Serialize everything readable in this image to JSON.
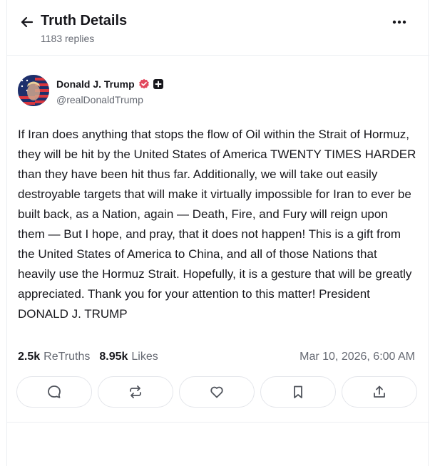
{
  "header": {
    "title": "Truth Details",
    "replies_count": "1183 replies",
    "back_icon": "arrow-left-icon",
    "more_icon": "more-horizontal-icon"
  },
  "author": {
    "display_name": "Donald J. Trump",
    "handle": "@realDonaldTrump",
    "verified_badge_color": "#e2475c"
  },
  "post": {
    "text": "If Iran does anything that stops the flow of Oil within the Strait of Hormuz, they will be hit by the United States of America TWENTY TIMES HARDER than they have been hit thus far. Additionally, we will take out easily destroyable targets that will make it virtually impossible for Iran to ever be built back, as a Nation, again — Death, Fire, and Fury will reign upon them — But I hope, and pray, that it does not happen! This is a gift from the United States of America to China, and all of those Nations that heavily use the Hormuz Strait. Hopefully, it is a gesture that will be greatly appreciated. Thank you for your attention to this matter! President DONALD J. TRUMP"
  },
  "stats": {
    "retruths_count": "2.5k",
    "retruths_label": "ReTruths",
    "likes_count": "8.95k",
    "likes_label": "Likes",
    "timestamp": "Mar 10, 2026, 6:00 AM"
  },
  "actions": [
    {
      "icon": "reply-icon"
    },
    {
      "icon": "retruth-icon"
    },
    {
      "icon": "heart-icon"
    },
    {
      "icon": "bookmark-icon"
    },
    {
      "icon": "share-icon"
    }
  ],
  "colors": {
    "text_primary": "#17171c",
    "text_secondary": "#666a73",
    "border": "#e4e6eb"
  }
}
